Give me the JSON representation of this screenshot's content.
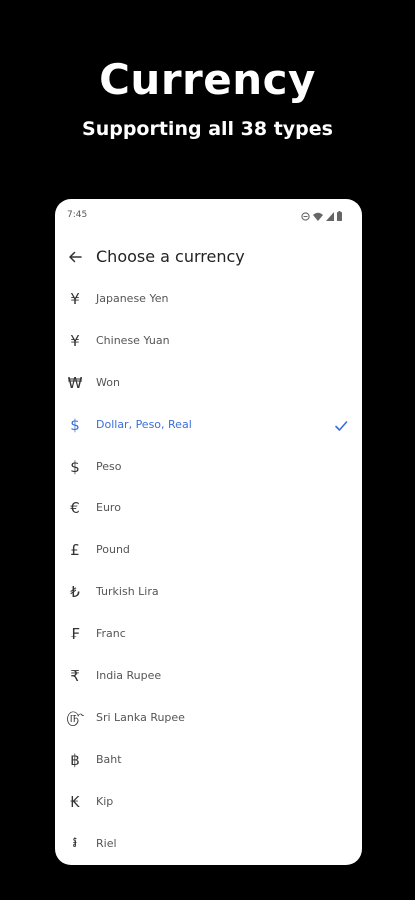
{
  "promo": {
    "title": "Currency",
    "subtitle": "Supporting all 38 types"
  },
  "status_bar": {
    "time": "7:45"
  },
  "app_bar": {
    "back_icon": "arrow-left-icon",
    "title": "Choose a currency"
  },
  "colors": {
    "selected": "#3a6fd8",
    "background": "#000000",
    "panel": "#ffffff"
  },
  "currencies": [
    {
      "symbol": "¥",
      "name": "Japanese Yen",
      "selected": false
    },
    {
      "symbol": "¥",
      "name": "Chinese Yuan",
      "selected": false
    },
    {
      "symbol": "₩",
      "name": "Won",
      "selected": false
    },
    {
      "symbol": "$",
      "name": "Dollar, Peso, Real",
      "selected": true
    },
    {
      "symbol": "$",
      "name": "Peso",
      "selected": false
    },
    {
      "symbol": "€",
      "name": "Euro",
      "selected": false
    },
    {
      "symbol": "£",
      "name": "Pound",
      "selected": false
    },
    {
      "symbol": "₺",
      "name": "Turkish Lira",
      "selected": false
    },
    {
      "symbol": "₣",
      "name": "Franc",
      "selected": false
    },
    {
      "symbol": "₹",
      "name": "India Rupee",
      "selected": false
    },
    {
      "symbol": "௹",
      "name": "Sri Lanka Rupee",
      "selected": false
    },
    {
      "symbol": "฿",
      "name": "Baht",
      "selected": false
    },
    {
      "symbol": "₭",
      "name": "Kip",
      "selected": false
    },
    {
      "symbol": "៛",
      "name": "Riel",
      "selected": false
    }
  ]
}
